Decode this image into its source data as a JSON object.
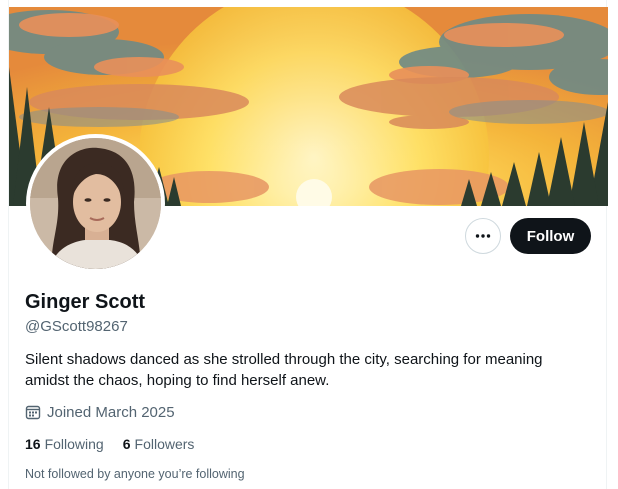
{
  "profile": {
    "name": "Ginger Scott",
    "handle": "@GScott98267",
    "bio": "Silent shadows danced as she strolled through the city, searching for meaning amidst the chaos, hoping to find herself anew.",
    "joined": "Joined March 2025",
    "following_count": "16",
    "following_label": "Following",
    "followers_count": "6",
    "followers_label": "Followers",
    "not_followed_text": "Not followed by anyone you’re following"
  },
  "actions": {
    "follow_label": "Follow",
    "more_icon": "more-horizontal-icon"
  },
  "icons": {
    "calendar": "calendar-icon"
  },
  "colors": {
    "text_primary": "#0f1419",
    "text_secondary": "#536471",
    "button_dark": "#0f1419",
    "banner_sun": "#f5c542",
    "border": "#cfd9de"
  }
}
